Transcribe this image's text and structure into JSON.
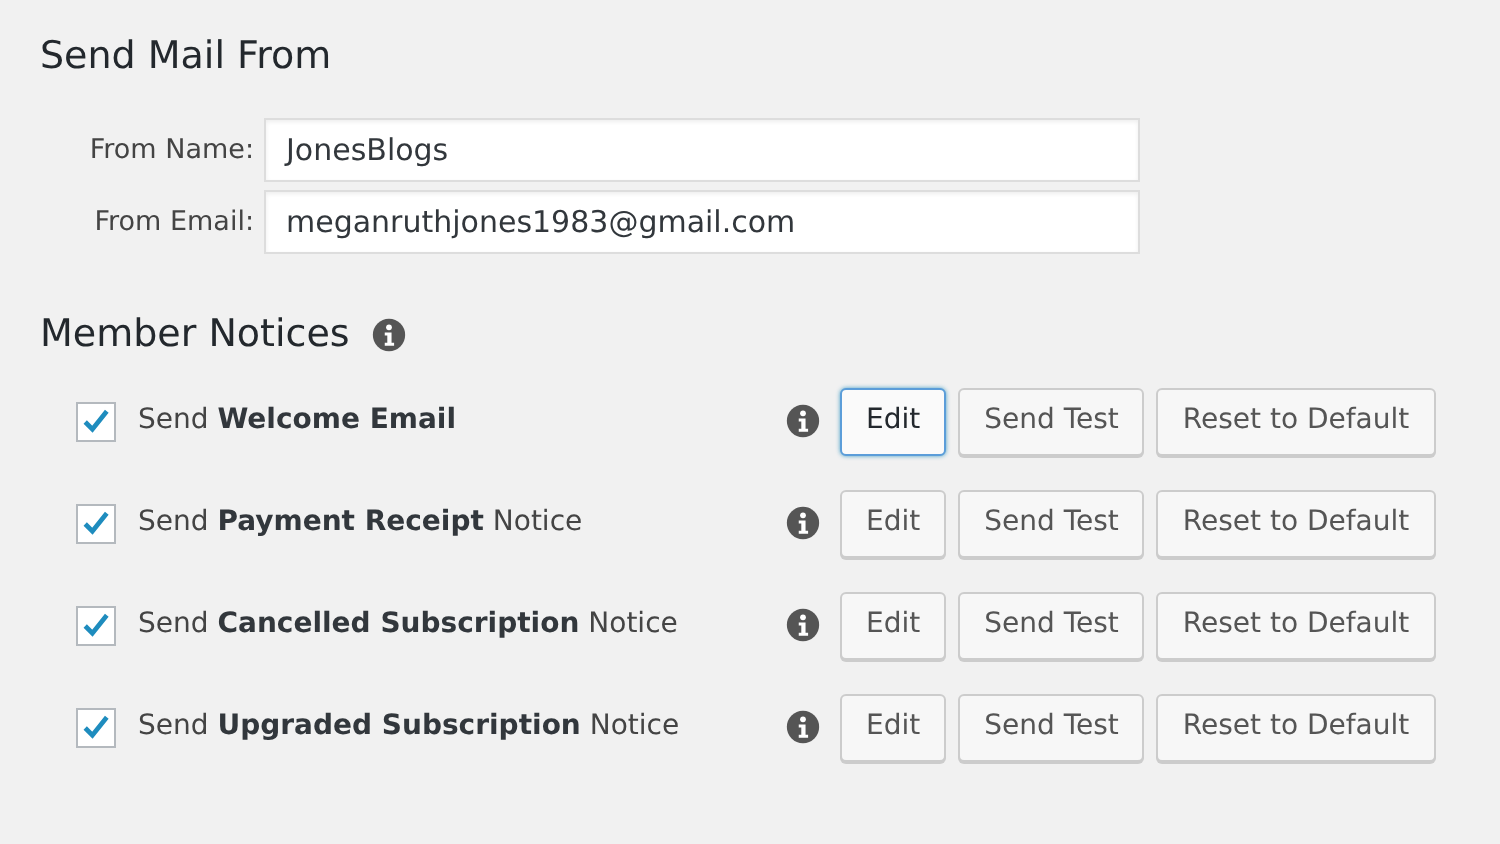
{
  "send_mail_from": {
    "title": "Send Mail From",
    "fields": [
      {
        "label": "From Name:",
        "value": "JonesBlogs"
      },
      {
        "label": "From Email:",
        "value": "meganruthjones1983@gmail.com"
      }
    ]
  },
  "member_notices": {
    "title": "Member Notices",
    "notices": [
      {
        "label": "Send **Welcome Email**",
        "checked": true,
        "buttons": [
          {
            "label": "Edit",
            "focused": true
          },
          {
            "label": "Send Test",
            "focused": false
          },
          {
            "label": "Reset to Default",
            "focused": false
          }
        ]
      },
      {
        "label": "Send **Payment Receipt** Notice",
        "checked": true,
        "buttons": [
          {
            "label": "Edit",
            "focused": false
          },
          {
            "label": "Send Test",
            "focused": false
          },
          {
            "label": "Reset to Default",
            "focused": false
          }
        ]
      },
      {
        "label": "Send **Cancelled Subscription** Notice",
        "checked": true,
        "buttons": [
          {
            "label": "Edit",
            "focused": false
          },
          {
            "label": "Send Test",
            "focused": false
          },
          {
            "label": "Reset to Default",
            "focused": false
          }
        ]
      },
      {
        "label": "Send **Upgraded Subscription** Notice",
        "checked": true,
        "buttons": [
          {
            "label": "Edit",
            "focused": false
          },
          {
            "label": "Send Test",
            "focused": false
          },
          {
            "label": "Reset to Default",
            "focused": false
          }
        ]
      }
    ]
  }
}
